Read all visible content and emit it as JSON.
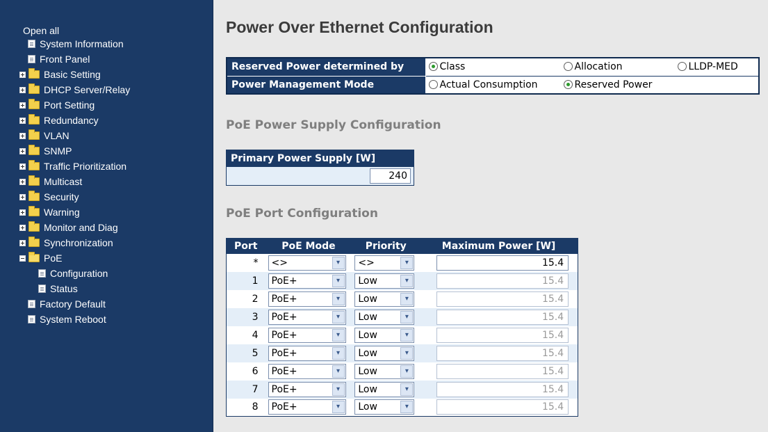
{
  "sidebar": {
    "open_all": "Open all",
    "items": [
      {
        "label": "System Information",
        "type": "page",
        "level": 1
      },
      {
        "label": "Front Panel",
        "type": "page",
        "level": 1
      },
      {
        "label": "Basic Setting",
        "type": "folder"
      },
      {
        "label": "DHCP Server/Relay",
        "type": "folder"
      },
      {
        "label": "Port Setting",
        "type": "folder"
      },
      {
        "label": "Redundancy",
        "type": "folder"
      },
      {
        "label": "VLAN",
        "type": "folder"
      },
      {
        "label": "SNMP",
        "type": "folder"
      },
      {
        "label": "Traffic Prioritization",
        "type": "folder"
      },
      {
        "label": "Multicast",
        "type": "folder"
      },
      {
        "label": "Security",
        "type": "folder"
      },
      {
        "label": "Warning",
        "type": "folder"
      },
      {
        "label": "Monitor and Diag",
        "type": "folder"
      },
      {
        "label": "Synchronization",
        "type": "folder"
      },
      {
        "label": "PoE",
        "type": "folder-open"
      },
      {
        "label": "Configuration",
        "type": "page",
        "level": 2
      },
      {
        "label": "Status",
        "type": "page",
        "level": 2
      },
      {
        "label": "Factory Default",
        "type": "page",
        "level": 1
      },
      {
        "label": "System Reboot",
        "type": "page",
        "level": 1
      }
    ]
  },
  "page_title": "Power Over Ethernet Configuration",
  "reserved": {
    "row1_label": "Reserved Power determined by",
    "row1_options": [
      "Class",
      "Allocation",
      "LLDP-MED"
    ],
    "row1_selected": "Class",
    "row2_label": "Power Management Mode",
    "row2_options": [
      "Actual Consumption",
      "Reserved Power"
    ],
    "row2_selected": "Reserved Power"
  },
  "supply": {
    "heading": "PoE Power Supply Configuration",
    "col": "Primary Power Supply [W]",
    "value": "240"
  },
  "ports": {
    "heading": "PoE Port Configuration",
    "columns": [
      "Port",
      "PoE Mode",
      "Priority",
      "Maximum Power [W]"
    ],
    "rows": [
      {
        "port": "*",
        "mode": "<>",
        "priority": "<>",
        "power": "15.4",
        "enabled": true
      },
      {
        "port": "1",
        "mode": "PoE+",
        "priority": "Low",
        "power": "15.4",
        "enabled": false
      },
      {
        "port": "2",
        "mode": "PoE+",
        "priority": "Low",
        "power": "15.4",
        "enabled": false
      },
      {
        "port": "3",
        "mode": "PoE+",
        "priority": "Low",
        "power": "15.4",
        "enabled": false
      },
      {
        "port": "4",
        "mode": "PoE+",
        "priority": "Low",
        "power": "15.4",
        "enabled": false
      },
      {
        "port": "5",
        "mode": "PoE+",
        "priority": "Low",
        "power": "15.4",
        "enabled": false
      },
      {
        "port": "6",
        "mode": "PoE+",
        "priority": "Low",
        "power": "15.4",
        "enabled": false
      },
      {
        "port": "7",
        "mode": "PoE+",
        "priority": "Low",
        "power": "15.4",
        "enabled": false
      },
      {
        "port": "8",
        "mode": "PoE+",
        "priority": "Low",
        "power": "15.4",
        "enabled": false
      }
    ]
  }
}
